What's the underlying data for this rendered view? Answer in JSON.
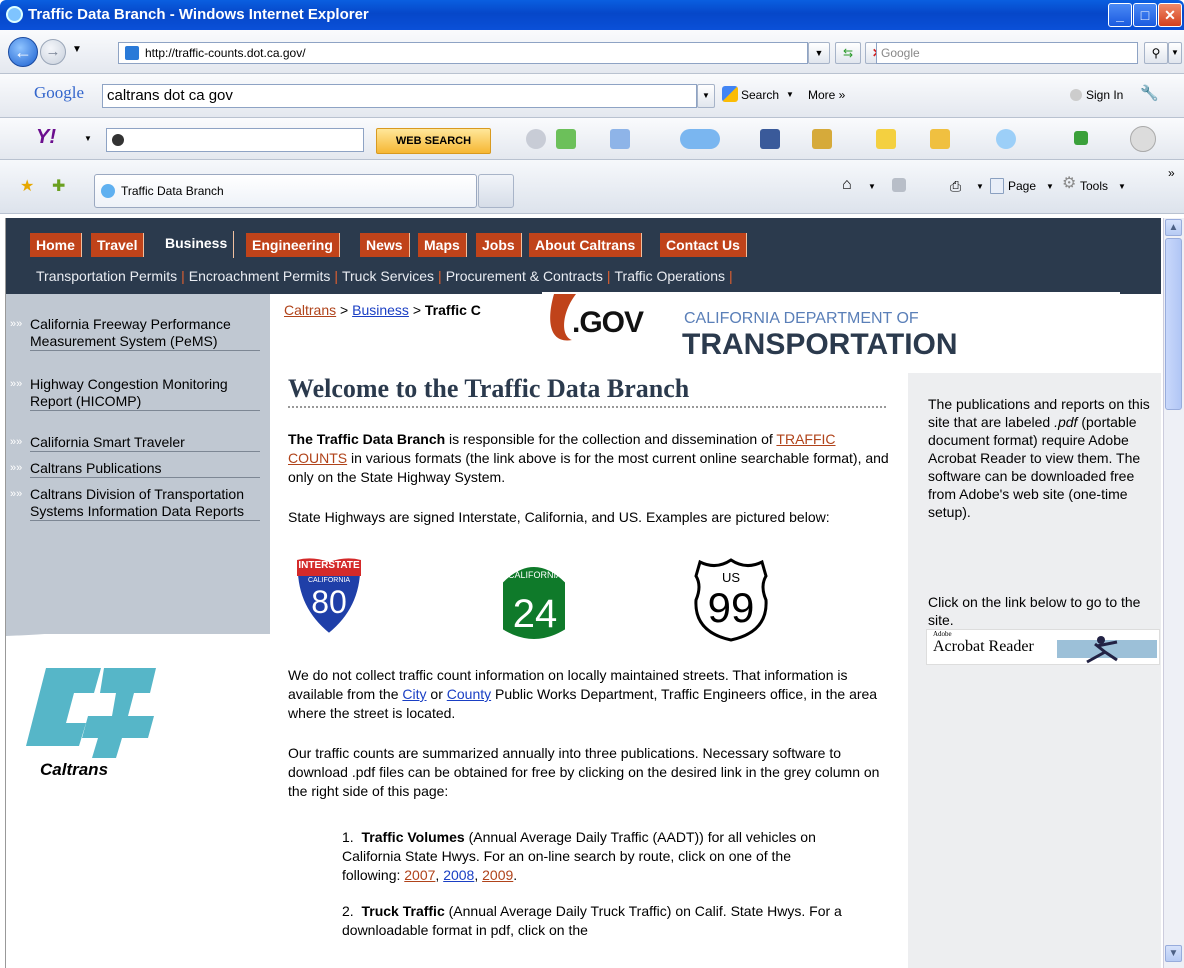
{
  "window": {
    "title": "Traffic Data Branch - Windows Internet Explorer"
  },
  "nav": {
    "address": "http://traffic-counts.dot.ca.gov/",
    "search_placeholder": "Google"
  },
  "google_toolbar": {
    "logo": "Google",
    "query": "caltrans dot ca gov",
    "search_label": "Search",
    "more_label": "More »",
    "signin_label": "Sign In"
  },
  "yahoo_toolbar": {
    "logo": "Y!",
    "web_search_label": "WEB SEARCH"
  },
  "tabs": {
    "active_tab": "Traffic Data Branch",
    "page_label": "Page",
    "tools_label": "Tools"
  },
  "site": {
    "top_nav": [
      "Home",
      "Travel",
      "Business",
      "Engineering",
      "News",
      "Maps",
      "Jobs",
      "About Caltrans",
      "Contact Us"
    ],
    "sub_nav": [
      "Transportation Permits",
      "Encroachment Permits",
      "Truck Services",
      "Procurement & Contracts",
      "Traffic Operations"
    ],
    "left_links": [
      "California Freeway Performance Measurement System (PeMS)",
      "Highway Congestion Monitoring Report (HICOMP)",
      "California Smart Traveler",
      "Caltrans Publications",
      "Caltrans Division of Transportation Systems Information Data Reports"
    ],
    "caltrans_logo_text": "Caltrans",
    "breadcrumb": {
      "a": "Caltrans",
      "sep": ">",
      "b": "Business",
      "c": "Traffic C"
    },
    "banner": {
      "gov": ".GOV",
      "dept": "CALIFORNIA DEPARTMENT OF",
      "transportation": "TRANSPORTATION"
    },
    "heading": "Welcome to the Traffic Data Branch",
    "p1": {
      "bold": "The Traffic Data Branch",
      "text1": " is responsible for the collection and dissemination of ",
      "link": "TRAFFIC COUNTS",
      "text2": " in various formats (the link above is for the most current online searchable format), and only on the State Highway System."
    },
    "p2": "State Highways are signed Interstate, California, and US.  Examples are pictured below:",
    "signs": {
      "interstate_top": "INTERSTATE",
      "interstate_state": "CALIFORNIA",
      "interstate_num": "80",
      "ca_label": "CALIFORNIA",
      "ca_num": "24",
      "us_label": "US",
      "us_num": "99"
    },
    "p3": {
      "text1": "We do not collect traffic count information on locally maintained streets. That information is available from the ",
      "city": "City",
      "or": " or ",
      "county": "County",
      "text2": " Public Works Department, Traffic Engineers office, in the area where the street is located."
    },
    "p4": "Our traffic counts are summarized annually into three publications. Necessary software to download .pdf files can be obtained for free by clicking on the desired link in the grey column on the right side of this page:",
    "item1": {
      "num": "1.",
      "bold": "Traffic Volumes",
      "text": " (Annual Average Daily Traffic (AADT)) for all vehicles on California State Hwys. For an on-line search by route, click on one of the following: ",
      "y1": "2007",
      "y2": "2008",
      "y3": "2009",
      "end": "."
    },
    "item2": {
      "num": "2.",
      "bold": "Truck Traffic",
      "text": " (Annual Average Daily Truck Traffic) on Calif. State Hwys. For a downloadable format in pdf, click on the"
    },
    "right": {
      "r1a": "The publications and reports on this site that are labeled ",
      "pdf": ".pdf",
      "r1b": " (portable document format) require Adobe Acrobat Reader to view them. The software can be downloaded free from Adobe's web site (one-time setup).",
      "r2": "Click on the link below to go to the site.",
      "adobe_small": "Adobe",
      "acrobat": "Acrobat Reader"
    }
  }
}
